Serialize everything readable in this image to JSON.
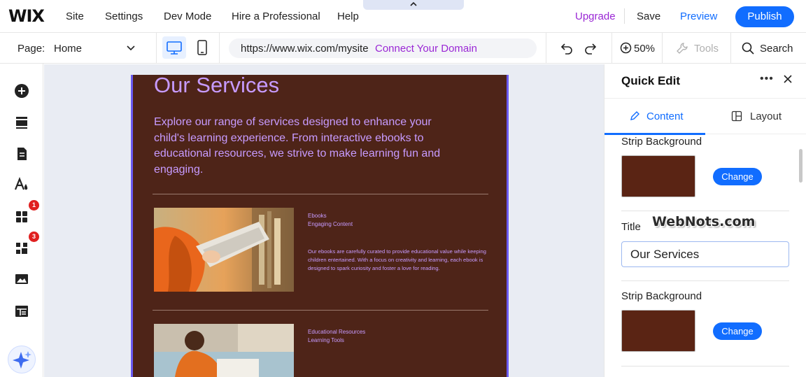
{
  "topbar": {
    "logo": "WIX",
    "menu": [
      "Site",
      "Settings",
      "Dev Mode",
      "Hire a Professional",
      "Help"
    ],
    "upgrade": "Upgrade",
    "save": "Save",
    "preview": "Preview",
    "publish": "Publish",
    "collapse_icon": "chevron-up-icon"
  },
  "toolbar": {
    "page_label": "Page:",
    "page_value": "Home",
    "url": "https://www.wix.com/mysite",
    "connect_domain": "Connect Your Domain",
    "zoom": "50%",
    "tools": "Tools",
    "search": "Search",
    "selected_view": "desktop"
  },
  "left_rail": {
    "icons": [
      "add-elements-icon",
      "sections-icon",
      "pages-icon",
      "design-icon",
      "apps-icon",
      "business-icon",
      "media-icon",
      "cms-icon",
      "ai-assistant-icon"
    ],
    "apps_badge": "1",
    "business_badge": "3"
  },
  "canvas": {
    "title": "Our Services",
    "description": "Explore our range of services designed to enhance your child's learning experience. From interactive ebooks to educational resources, we strive to make learning fun and engaging.",
    "services": [
      {
        "category": "Ebooks",
        "subtitle": "Engaging Content",
        "body": "Our ebooks are carefully curated to provide educational value while keeping children entertained. With a focus on creativity and learning, each ebook is designed to spark curiosity and foster a love for reading."
      },
      {
        "category": "Educational Resources",
        "subtitle": "Learning Tools"
      }
    ]
  },
  "panel": {
    "title": "Quick Edit",
    "tabs": [
      "Content",
      "Layout"
    ],
    "strip_bg_label_1": "Strip Background",
    "change_1": "Change",
    "title_label": "Title",
    "title_value": "Our Services",
    "strip_bg_label_2": "Strip Background",
    "change_2": "Change",
    "swatch_color": "#5a2414",
    "watermark": "WebNots.com"
  },
  "colors": {
    "accent": "#116dff",
    "upgrade": "#9a27d5",
    "strip_bg": "#4e2418",
    "strip_text": "#c79bff"
  }
}
